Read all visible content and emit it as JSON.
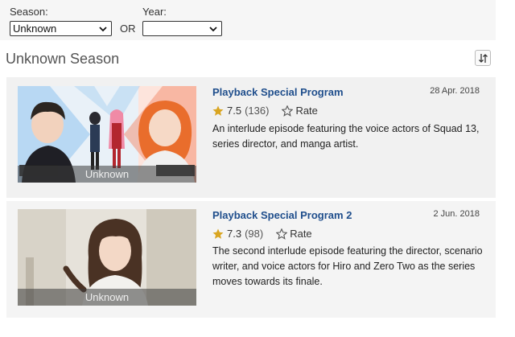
{
  "filters": {
    "season_label": "Season:",
    "season_value": "Unknown",
    "or_label": "OR",
    "year_label": "Year:",
    "year_value": ""
  },
  "section": {
    "title": "Unknown Season",
    "sort_icon": "sort-icon"
  },
  "episodes": [
    {
      "title": "Playback Special Program",
      "date": "28 Apr. 2018",
      "rating": "7.5",
      "votes": "(136)",
      "rate_label": "Rate",
      "synopsis": "An interlude episode featuring the voice actors of Squad 13, series director, and manga artist.",
      "thumb_caption": "Unknown"
    },
    {
      "title": "Playback Special Program 2",
      "date": "2 Jun. 2018",
      "rating": "7.3",
      "votes": "(98)",
      "rate_label": "Rate",
      "synopsis": "The second interlude episode featuring the director, scenario writer, and voice actors for Hiro and Zero Two as the series moves towards its finale.",
      "thumb_caption": "Unknown"
    }
  ],
  "colors": {
    "title_link": "#1f4e8c",
    "star": "#d9a521",
    "row_bg": "#f1f1f1"
  }
}
